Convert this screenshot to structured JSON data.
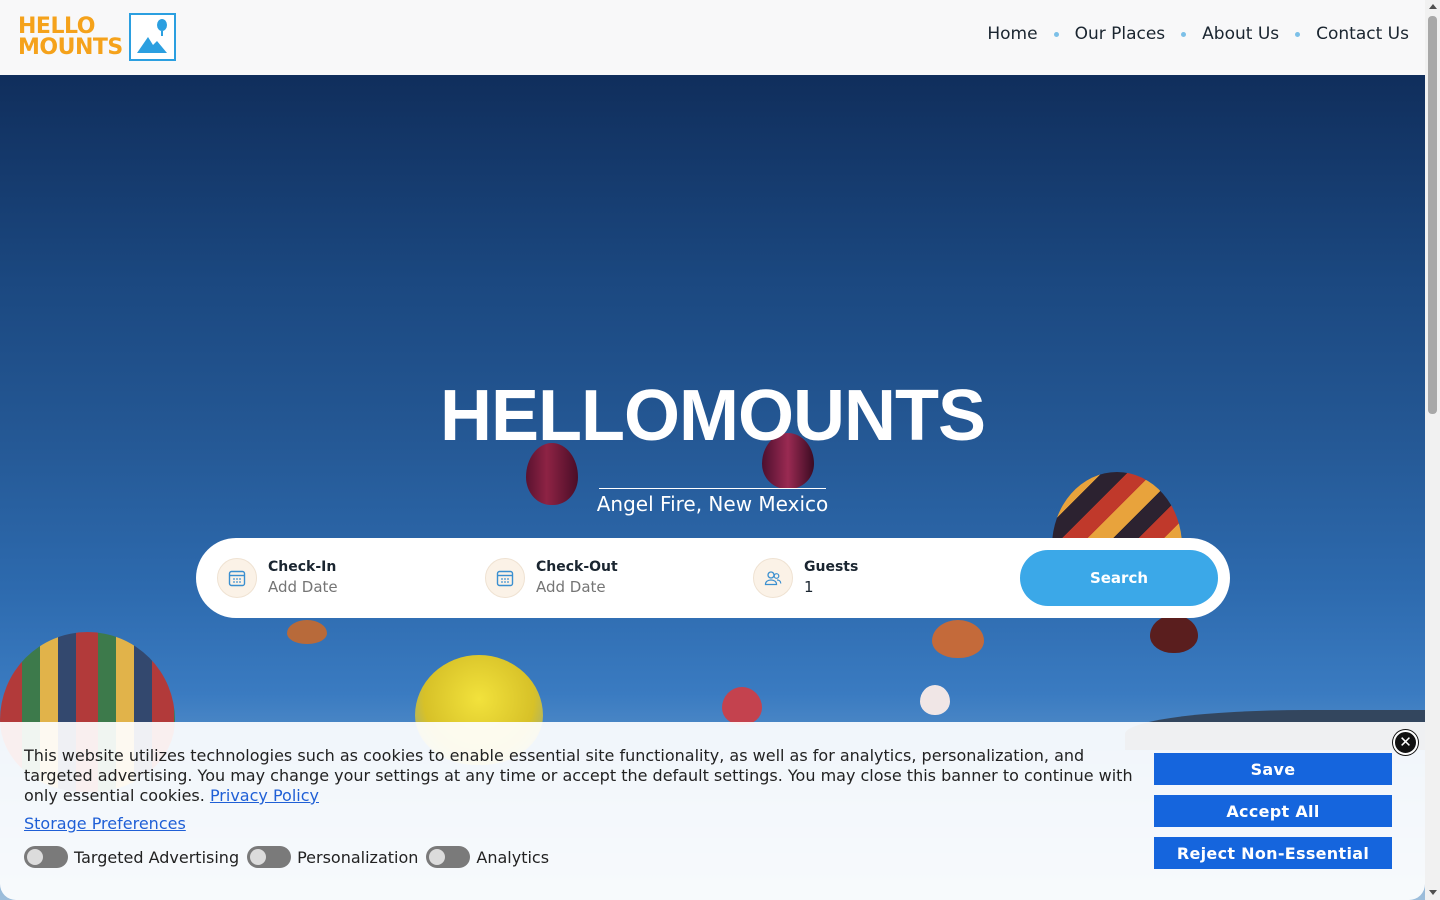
{
  "brand": {
    "line1": "HELLO",
    "line2": "MOUNTS",
    "accent": "#f5a21b",
    "blue": "#2b9fe0"
  },
  "nav": {
    "items": [
      "Home",
      "Our Places",
      "About Us",
      "Contact Us"
    ]
  },
  "hero": {
    "title": "HELLOMOUNTS",
    "subtitle": "Angel Fire, New Mexico"
  },
  "search": {
    "checkin": {
      "label": "Check-In",
      "placeholder": "Add Date",
      "icon": "calendar-icon"
    },
    "checkout": {
      "label": "Check-Out",
      "placeholder": "Add Date",
      "icon": "calendar-icon"
    },
    "guests": {
      "label": "Guests",
      "value": "1",
      "icon": "users-icon"
    },
    "button": "Search",
    "button_color": "#3ba8e8"
  },
  "cookie": {
    "text": "This website utilizes technologies such as cookies to enable essential site functionality, as well as for analytics, personalization, and targeted advertising. You may change your settings at any time or accept the default settings. You may close this banner to continue with only essential cookies.",
    "privacy_link": "Privacy Policy",
    "storage_link": "Storage Preferences",
    "toggles": [
      "Targeted Advertising",
      "Personalization",
      "Analytics"
    ],
    "save": "Save",
    "accept": "Accept All",
    "reject": "Reject Non-Essential",
    "button_color": "#1565dd"
  }
}
